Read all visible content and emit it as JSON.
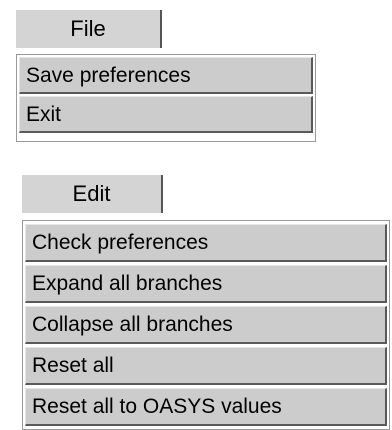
{
  "menus": {
    "file": {
      "label": "File",
      "items": [
        {
          "label": "Save preferences"
        },
        {
          "label": "Exit"
        }
      ]
    },
    "edit": {
      "label": "Edit",
      "items": [
        {
          "label": "Check preferences"
        },
        {
          "label": "Expand all branches"
        },
        {
          "label": "Collapse all branches"
        },
        {
          "label": "Reset all"
        },
        {
          "label": "Reset all to OASYS values"
        }
      ]
    }
  },
  "colors": {
    "button_face": "#cccccc",
    "shadow": "#5a5a5a",
    "highlight": "#e6e6e6",
    "background": "#ffffff"
  }
}
